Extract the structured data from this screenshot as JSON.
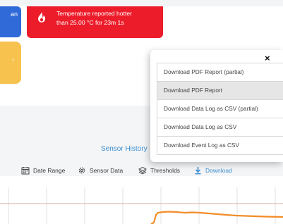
{
  "alerts": {
    "left_card_text": "an",
    "temperature_alert": {
      "icon": "flame-icon",
      "line1": "Temperature reported hotter",
      "line2": "than 25.00 °C for 23m 1s"
    }
  },
  "sensor_history_title": "Sensor History",
  "toolbar": {
    "date_range": "Date Range",
    "sensor_data": "Sensor Data",
    "thresholds": "Thresholds",
    "download": "Download"
  },
  "download_menu": {
    "close_symbol": "×",
    "items": [
      "Download PDF Report (partial)",
      "Download PDF Report",
      "Download Data Log as CSV (partial)",
      "Download Data Log as CSV",
      "Download Event Log as CSV"
    ],
    "highlighted_item": "Download PDF Report"
  },
  "colors": {
    "alert_red": "#ec1c2a",
    "alert_blue": "#2f6ad8",
    "alert_yellow": "#f7c24e",
    "link_blue": "#3d8fd1",
    "series_orange": "#f28c28"
  }
}
